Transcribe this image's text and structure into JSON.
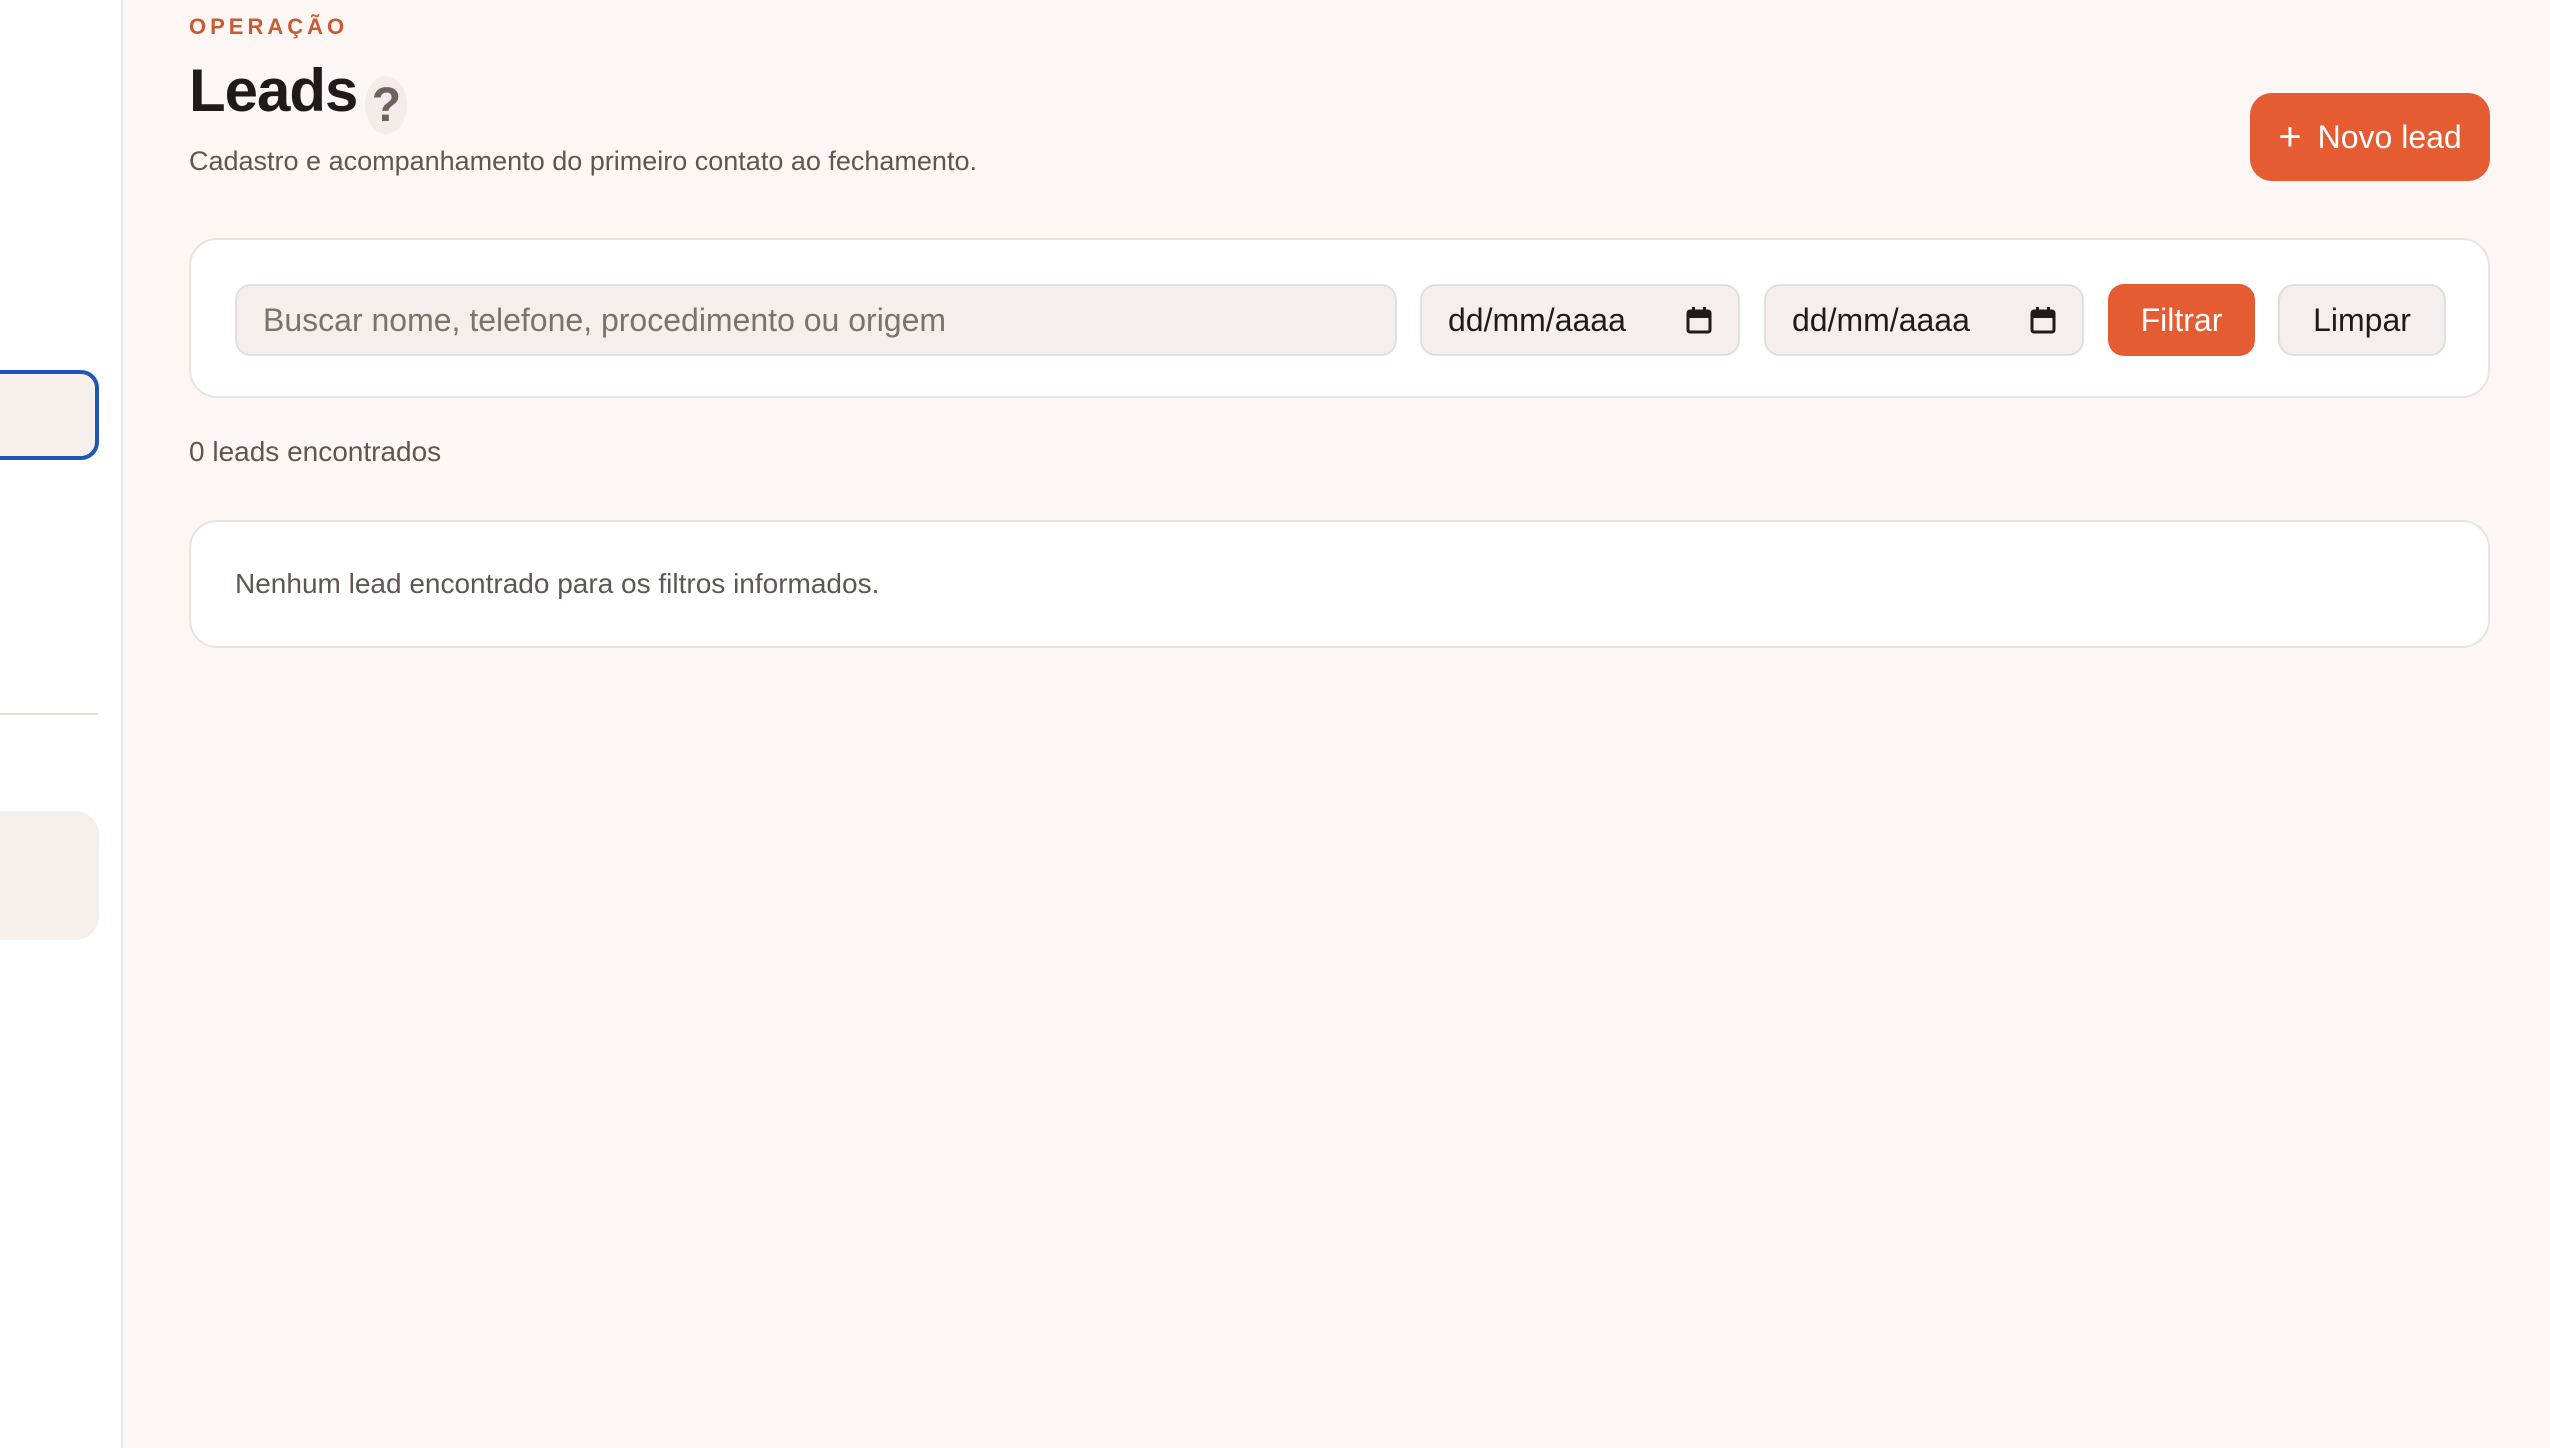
{
  "header": {
    "eyebrow": "OPERAÇÃO",
    "title": "Leads",
    "help_glyph": "?",
    "subtitle": "Cadastro e acompanhamento do primeiro contato ao fechamento.",
    "new_lead_label": "Novo lead",
    "new_lead_icon": "plus-icon"
  },
  "filters": {
    "search_placeholder": "Buscar nome, telefone, procedimento ou origem",
    "search_value": "",
    "date_from_placeholder": "dd/mm/aaaa",
    "date_to_placeholder": "dd/mm/aaaa",
    "calendar_icon": "calendar-icon",
    "filter_label": "Filtrar",
    "clear_label": "Limpar"
  },
  "results": {
    "count_text": "0 leads encontrados",
    "empty_message": "Nenhum lead encontrado para os filtros informados."
  },
  "colors": {
    "accent": "#e55b32",
    "eyebrow": "#c85a35",
    "page_bg": "#fcf7f4",
    "sidebar_active_border": "#1f55b8"
  }
}
